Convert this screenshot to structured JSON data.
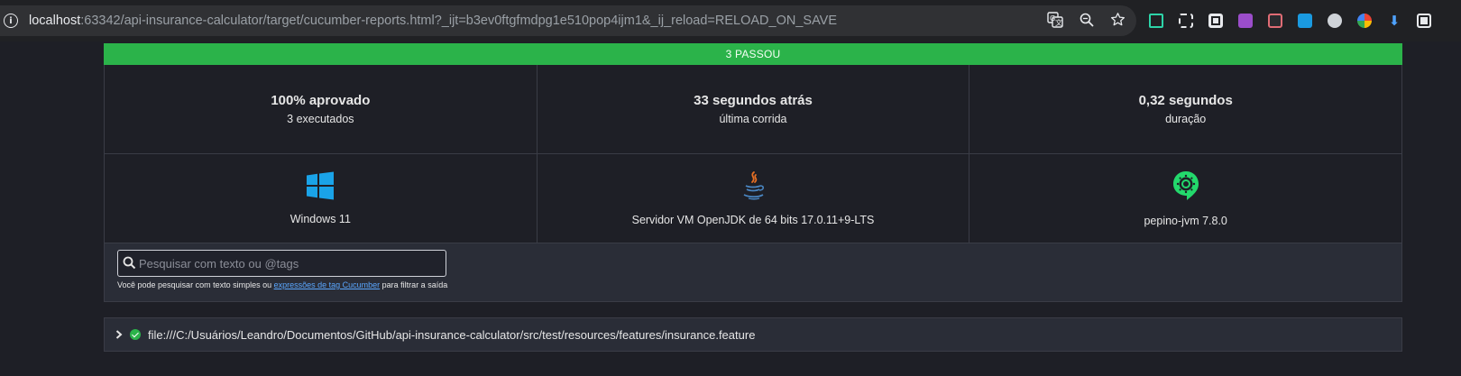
{
  "browser": {
    "url_host": "localhost",
    "url_rest": ":63342/api-insurance-calculator/target/cucumber-reports.html?_ijt=b3ev0ftgfmdpg1e510pop4ijm1&_ij_reload=RELOAD_ON_SAVE",
    "info_glyph": "i",
    "icons": [
      "translate-icon",
      "zoom-icon",
      "bookmark-star-icon"
    ],
    "extensions": [
      "ext-1-icon",
      "ext-2-icon",
      "ext-3-icon",
      "ext-4-icon",
      "ext-5-icon",
      "ext-6-icon",
      "ext-7-icon",
      "ext-8-icon",
      "download-icon",
      "ext-10-icon"
    ]
  },
  "report": {
    "banner": "3 PASSOU",
    "summary": [
      {
        "value": "100% aprovado",
        "label": "3 executados"
      },
      {
        "value": "33 segundos atrás",
        "label": "última corrida"
      },
      {
        "value": "0,32 segundos",
        "label": "duração"
      }
    ],
    "environment": [
      {
        "label": "Windows 11",
        "icon": "windows-icon"
      },
      {
        "label": "Servidor VM OpenJDK de 64 bits 17.0.11+9-LTS",
        "icon": "java-icon"
      },
      {
        "label": "pepino-jvm 7.8.0",
        "icon": "cucumber-icon"
      }
    ],
    "search": {
      "placeholder": "Pesquisar com texto ou @tags",
      "help_prefix": "Você pode pesquisar com texto simples ou ",
      "help_link": "expressões de tag Cucumber",
      "help_suffix": " para filtrar a saída"
    },
    "feature": {
      "path": "file:///C:/Usuários/Leandro/Documentos/GitHub/api-insurance-calculator/src/test/resources/features/insurance.feature",
      "status": "passed"
    }
  },
  "colors": {
    "passed": "#2bb34a",
    "background": "#1e1f26",
    "panel": "#2a2d37",
    "link": "#5aa7ff"
  }
}
